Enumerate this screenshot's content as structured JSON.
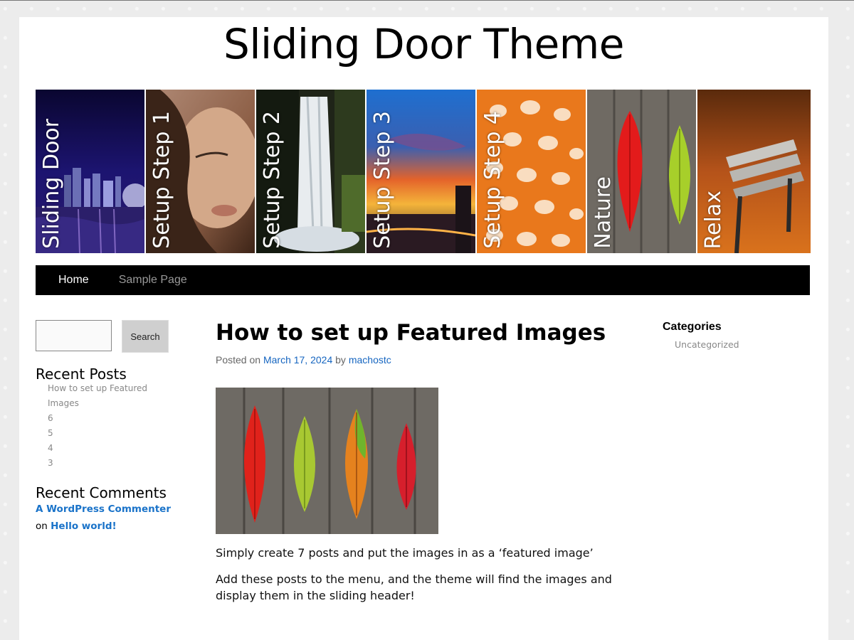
{
  "site": {
    "title": "Sliding Door Theme"
  },
  "slider": {
    "slides": [
      {
        "label": "Sliding Door",
        "theme": "city-night"
      },
      {
        "label": "Setup Step 1",
        "theme": "portrait"
      },
      {
        "label": "Setup Step 2",
        "theme": "waterfall"
      },
      {
        "label": "Setup Step 3",
        "theme": "sunset-city"
      },
      {
        "label": "Setup Step 4",
        "theme": "fish-scales"
      },
      {
        "label": "Nature",
        "theme": "leaves"
      },
      {
        "label": "Relax",
        "theme": "autumn-bench"
      }
    ]
  },
  "nav": {
    "items": [
      {
        "label": "Home",
        "active": true
      },
      {
        "label": "Sample Page",
        "active": false
      }
    ]
  },
  "sidebar_left": {
    "search": {
      "button_label": "Search",
      "value": "",
      "placeholder": ""
    },
    "recent_posts": {
      "title": "Recent Posts",
      "items": [
        "How to set up Featured Images",
        "6",
        "5",
        "4",
        "3"
      ]
    },
    "recent_comments": {
      "title": "Recent Comments",
      "author": "A WordPress Commenter",
      "connector": "on",
      "post": "Hello world!"
    }
  },
  "post": {
    "title": "How to set up Featured Images",
    "meta": {
      "posted_on": "Posted on",
      "date": "March 17, 2024",
      "by": "by",
      "author": "machostc"
    },
    "paragraphs": [
      "Simply create 7 posts and put the images in as a ‘featured image’",
      "Add these posts to the menu, and the theme will find the images and display them in the sliding header!"
    ]
  },
  "sidebar_right": {
    "categories": {
      "title": "Categories",
      "items": [
        "Uncategorized"
      ]
    }
  },
  "colors": {
    "link": "#1565c0",
    "nav_bg": "#000000",
    "muted": "#888888"
  }
}
